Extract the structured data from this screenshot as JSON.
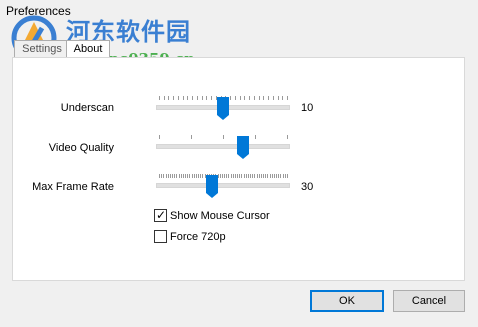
{
  "window": {
    "title": "Preferences"
  },
  "watermark": {
    "title": "河东软件园",
    "url": "www.pc0359.cn"
  },
  "tabs": [
    {
      "label": "Settings",
      "active": true
    },
    {
      "label": "About",
      "active": false
    }
  ],
  "sliders": [
    {
      "label": "Underscan",
      "value_text": "10",
      "level": 0.5
    },
    {
      "label": "Video Quality",
      "value_text": "",
      "level": 0.66
    },
    {
      "label": "Max Frame Rate",
      "value_text": "30",
      "level": 0.41
    }
  ],
  "checkboxes": [
    {
      "label": "Show Mouse Cursor",
      "checked": true
    },
    {
      "label": "Force 720p",
      "checked": false
    }
  ],
  "buttons": {
    "ok": "OK",
    "cancel": "Cancel"
  },
  "colors": {
    "accent": "#0078d7",
    "watermark_blue": "#3a7fd2",
    "watermark_green": "#4caf50"
  }
}
